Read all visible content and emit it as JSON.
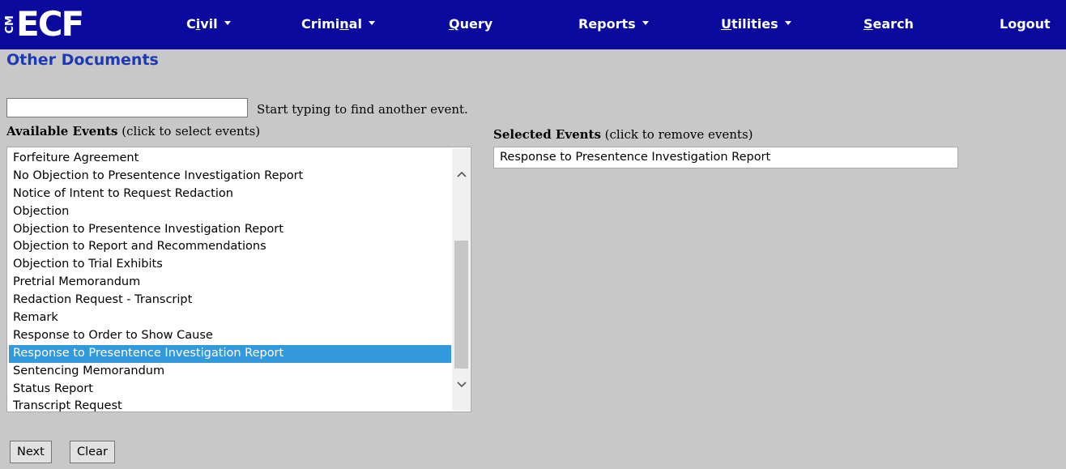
{
  "colors": {
    "nav_background": "#0a0a9e",
    "nav_text": "#ffffff",
    "page_title": "#1d39b5",
    "page_background": "#c8c8c8",
    "selection_highlight": "#3399dd"
  },
  "nav": {
    "logo_prefix": "CM",
    "logo_text": "ECF",
    "items": [
      {
        "label_pre": "C",
        "label_acc": "i",
        "label_post": "vil",
        "has_dropdown": true
      },
      {
        "label_pre": "Crimi",
        "label_acc": "n",
        "label_post": "al",
        "has_dropdown": true
      },
      {
        "label_pre": "",
        "label_acc": "Q",
        "label_post": "uery",
        "has_dropdown": false
      },
      {
        "label_pre": "Reports",
        "label_acc": "",
        "label_post": "",
        "has_dropdown": true
      },
      {
        "label_pre": "",
        "label_acc": "U",
        "label_post": "tilities",
        "has_dropdown": true
      },
      {
        "label_pre": "",
        "label_acc": "S",
        "label_post": "earch",
        "has_dropdown": false
      },
      {
        "label_pre": "Logout",
        "label_acc": "",
        "label_post": "",
        "has_dropdown": false
      }
    ]
  },
  "page": {
    "title": "Other Documents"
  },
  "search": {
    "value": "",
    "hint": "Start typing to find another event."
  },
  "available": {
    "label_bold": "Available Events",
    "label_rest": " (click to select events)",
    "items": [
      "Forfeiture Agreement",
      "No Objection to Presentence Investigation Report",
      "Notice of Intent to Request Redaction",
      "Objection",
      "Objection to Presentence Investigation Report",
      "Objection to Report and Recommendations",
      "Objection to Trial Exhibits",
      "Pretrial Memorandum",
      "Redaction Request - Transcript",
      "Remark",
      "Response to Order to Show Cause",
      "Response to Presentence Investigation Report",
      "Sentencing Memorandum",
      "Status Report",
      "Transcript Request"
    ],
    "selected_item": "Response to Presentence Investigation Report"
  },
  "selected": {
    "label_bold": "Selected Events",
    "label_rest": " (click to remove events)",
    "items": [
      "Response to Presentence Investigation Report"
    ]
  },
  "buttons": {
    "next": "Next",
    "clear": "Clear"
  }
}
